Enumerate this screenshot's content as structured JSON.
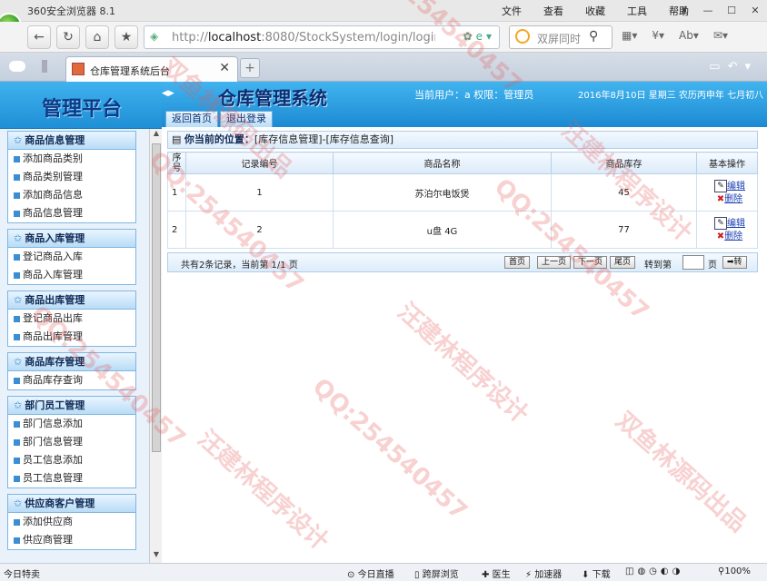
{
  "browser": {
    "app_name": "360安全浏览器 8.1",
    "menus": [
      "文件",
      "查看",
      "收藏",
      "工具",
      "帮助"
    ],
    "window_controls": [
      "♜",
      "—",
      "☐",
      "✕"
    ]
  },
  "address": {
    "url_scheme": "http://",
    "url_host": "localhost",
    "url_rest": ":8080/StockSystem/login/logir",
    "search_placeholder": "双屏同时"
  },
  "tab": {
    "title": "仓库管理系统后台"
  },
  "sidebar": {
    "logo": "管理平台",
    "groups": [
      {
        "title": "商品信息管理",
        "items": [
          "添加商品类别",
          "商品类别管理",
          "添加商品信息",
          "商品信息管理"
        ]
      },
      {
        "title": "商品入库管理",
        "items": [
          "登记商品入库",
          "商品入库管理"
        ]
      },
      {
        "title": "商品出库管理",
        "items": [
          "登记商品出库",
          "商品出库管理"
        ]
      },
      {
        "title": "商品库存管理",
        "items": [
          "商品库存查询"
        ]
      },
      {
        "title": "部门员工管理",
        "items": [
          "部门信息添加",
          "部门信息管理",
          "员工信息添加",
          "员工信息管理"
        ]
      },
      {
        "title": "供应商客户管理",
        "items": [
          "添加供应商",
          "供应商管理"
        ]
      }
    ]
  },
  "header": {
    "system_title": "仓库管理系统",
    "current_user": "当前用户：a 权限：管理员",
    "date": "2016年8月10日 星期三 农历丙申年 七月初八",
    "btn_home": "返回首页",
    "btn_logout": "退出登录"
  },
  "location": {
    "label": "你当前的位置：",
    "path": "[库存信息管理]-[库存信息查询]"
  },
  "table": {
    "headers": [
      "序号",
      "记录编号",
      "商品名称",
      "商品库存",
      "基本操作"
    ],
    "rows": [
      {
        "seq": "1",
        "record_id": "1",
        "name": "苏泊尔电饭煲",
        "stock": "45",
        "edit": "编辑",
        "del": "删除"
      },
      {
        "seq": "2",
        "record_id": "2",
        "name": "u盘 4G",
        "stock": "77",
        "edit": "编辑",
        "del": "删除"
      }
    ]
  },
  "pager": {
    "info": "共有2条记录，当前第 1/1 页",
    "first": "首页",
    "prev": "上一页",
    "next": "下一页",
    "last": "尾页",
    "goto": "转到第",
    "page_unit": "页",
    "go": "➡转"
  },
  "statusbar": {
    "left": "今日特卖",
    "live": "今日直播",
    "dual": "跨屏浏览",
    "doctor": "医生",
    "accel": "加速器",
    "download": "下载",
    "zoom": "100%"
  },
  "watermark": {
    "text1": "汪建林程序设计",
    "text2": "QQ:254540457",
    "text3": "双鱼林源码出品"
  }
}
